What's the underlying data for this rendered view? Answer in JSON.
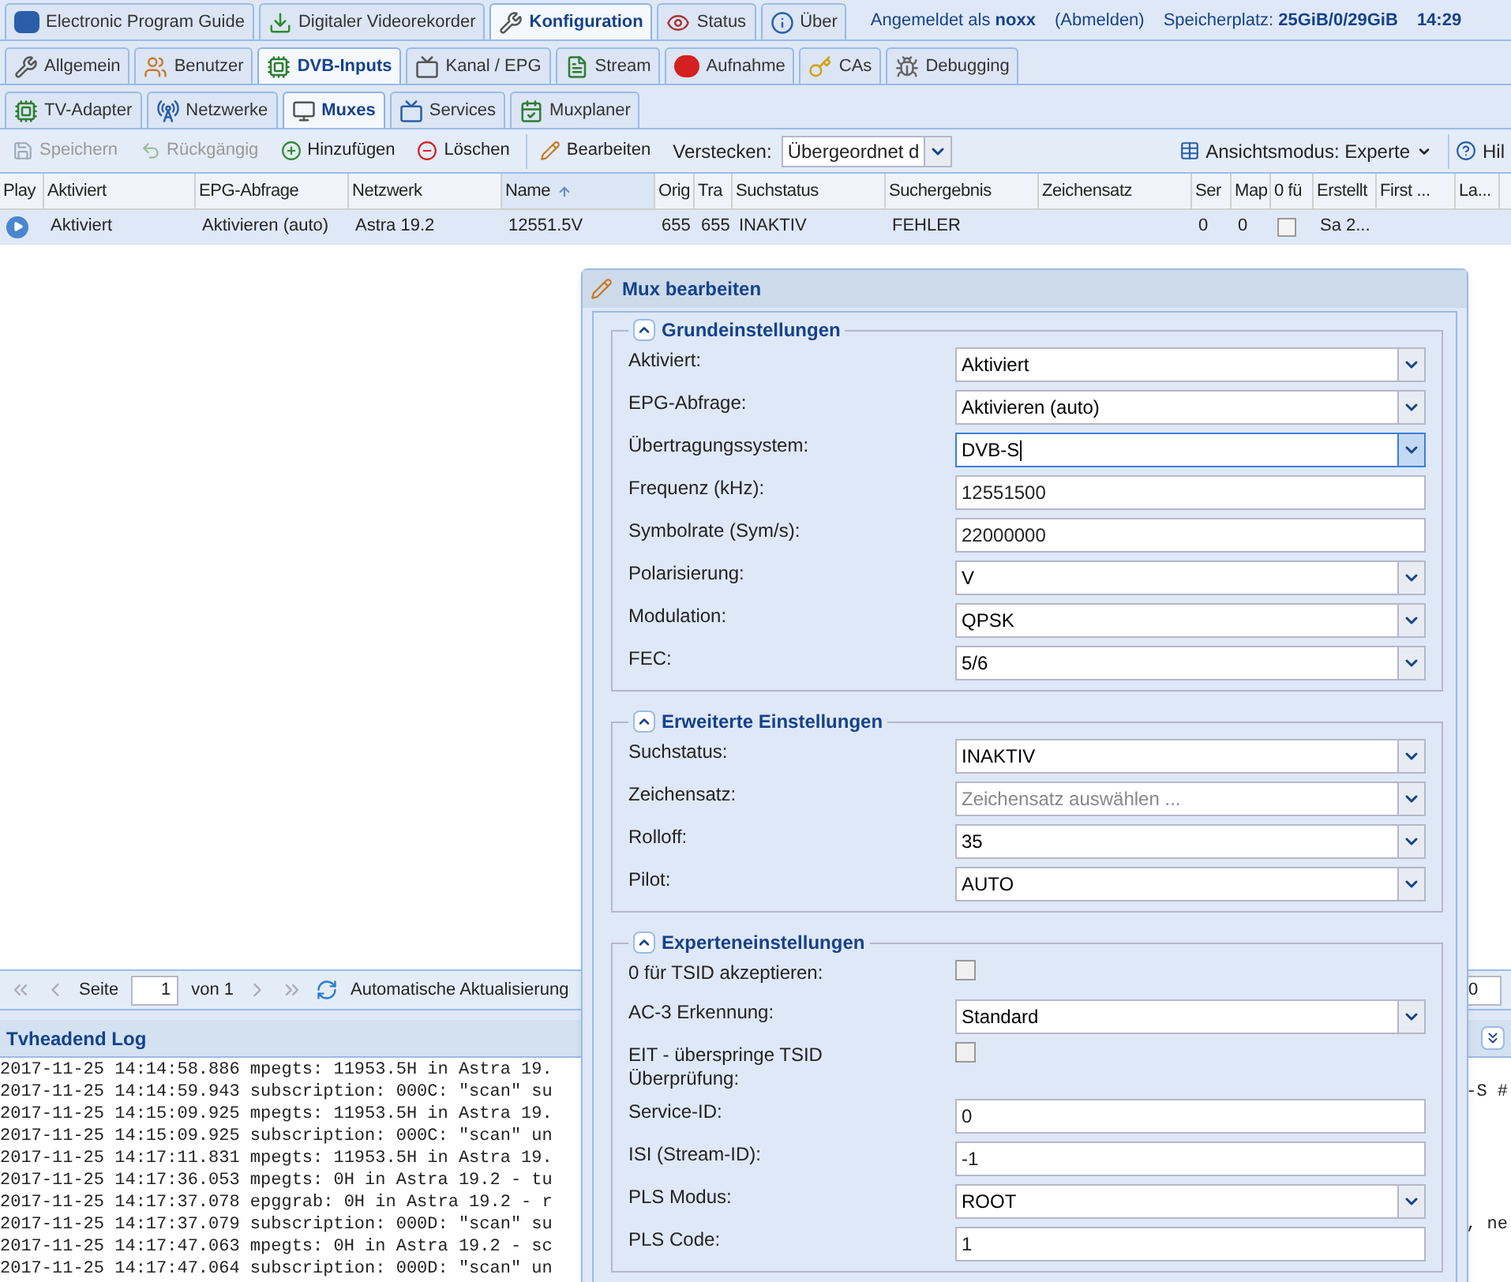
{
  "main_tabs": [
    {
      "label": "Electronic Program Guide",
      "selected": false
    },
    {
      "label": "Digitaler Videorekorder",
      "selected": false
    },
    {
      "label": "Konfiguration",
      "selected": true
    },
    {
      "label": "Status",
      "selected": false
    },
    {
      "label": "Über",
      "selected": false
    }
  ],
  "session": {
    "user": "Angemeldet als **noxx**",
    "logout": "(Abmelden)",
    "storage": "Speicherplatz: **25GiB/0/29GiB**",
    "time": "14:29"
  },
  "config_tabs": [
    {
      "label": "Allgemein",
      "selected": false
    },
    {
      "label": "Benutzer",
      "selected": false
    },
    {
      "label": "DVB-Inputs",
      "selected": true
    },
    {
      "label": "Kanal / EPG",
      "selected": false
    },
    {
      "label": "Stream",
      "selected": false
    },
    {
      "label": "Aufnahme",
      "selected": false
    },
    {
      "label": "CAs",
      "selected": false
    },
    {
      "label": "Debugging",
      "selected": false
    }
  ],
  "sub_tabs": [
    {
      "label": "TV-Adapter",
      "selected": false
    },
    {
      "label": "Netzwerke",
      "selected": false
    },
    {
      "label": "Muxes",
      "selected": true
    },
    {
      "label": "Services",
      "selected": false
    },
    {
      "label": "Muxplaner",
      "selected": false
    }
  ],
  "toolbar": {
    "buttons": [
      {
        "label": "Speichern",
        "disabled": true
      },
      {
        "label": "Rückgängig",
        "disabled": true
      },
      {
        "label": "Hinzufügen",
        "disabled": false
      },
      {
        "label": "Löschen",
        "disabled": false
      },
      {
        "label": "Bearbeiten",
        "disabled": false
      }
    ],
    "hide_label": "Verstecken:",
    "hide_value": "Übergeordnet d",
    "view_mode": "Ansichtsmodus: Experte",
    "help": "Hil"
  },
  "table": {
    "columns": [
      {
        "label": "Play",
        "sorted": false
      },
      {
        "label": "Aktiviert",
        "sorted": false
      },
      {
        "label": "EPG-Abfrage",
        "sorted": false
      },
      {
        "label": "Netzwerk",
        "sorted": false
      },
      {
        "label": "Name",
        "sorted": true
      },
      {
        "label": "Orig",
        "sorted": false
      },
      {
        "label": "Tra",
        "sorted": false
      },
      {
        "label": "Suchstatus",
        "sorted": false
      },
      {
        "label": "Suchergebnis",
        "sorted": false
      },
      {
        "label": "Zeichensatz",
        "sorted": false
      },
      {
        "label": "Ser",
        "sorted": false
      },
      {
        "label": "Map",
        "sorted": false
      },
      {
        "label": "0 fü",
        "sorted": false
      },
      {
        "label": "Erstellt",
        "sorted": false
      },
      {
        "label": "First ...",
        "sorted": false
      },
      {
        "label": "La...",
        "sorted": false
      }
    ],
    "rows": [
      {
        "selected": true,
        "cells": [
          {
            "kind": "play"
          },
          {
            "kind": "text",
            "text": "Aktiviert"
          },
          {
            "kind": "text",
            "text": "Aktivieren (auto)"
          },
          {
            "kind": "text",
            "text": "Astra 19.2"
          },
          {
            "kind": "text",
            "text": "12551.5V"
          },
          {
            "kind": "text",
            "text": "655"
          },
          {
            "kind": "text",
            "text": "655"
          },
          {
            "kind": "text",
            "text": "INAKTIV"
          },
          {
            "kind": "text",
            "text": "FEHLER"
          },
          {
            "kind": "empty"
          },
          {
            "kind": "text",
            "text": "0"
          },
          {
            "kind": "text",
            "text": "0"
          },
          {
            "kind": "checkbox",
            "checked": false
          },
          {
            "kind": "text",
            "text": "Sa 2..."
          },
          {
            "kind": "empty"
          },
          {
            "kind": "empty"
          }
        ]
      }
    ]
  },
  "paging": {
    "page_label": "Seite",
    "page": "1",
    "of": "von 1",
    "auto_refresh": "Automatische Aktualisierung",
    "page_size": "0"
  },
  "log": {
    "title": "Tvheadend Log",
    "lines": [
      {
        "text": "2017-11-25 14:14:58.886 mpegts: 11953.5H in Astra 19."
      },
      {
        "text": "2017-11-25 14:14:59.943 subscription: 000C: \"scan\" su",
        "tail": "-S #"
      },
      {
        "text": "2017-11-25 14:15:09.925 mpegts: 11953.5H in Astra 19."
      },
      {
        "text": "2017-11-25 14:15:09.925 subscription: 000C: \"scan\" un"
      },
      {
        "text": "2017-11-25 14:17:11.831 mpegts: 11953.5H in Astra 19."
      },
      {
        "text": "2017-11-25 14:17:36.053 mpegts: 0H in Astra 19.2 - tu"
      },
      {
        "text": "2017-11-25 14:17:37.078 epggrab: 0H in Astra 19.2 - r"
      },
      {
        "text": "2017-11-25 14:17:37.079 subscription: 000D: \"scan\" su",
        "tail": ", ne"
      },
      {
        "text": "2017-11-25 14:17:47.063 mpegts: 0H in Astra 19.2 - sc"
      },
      {
        "text": "2017-11-25 14:17:47.064 subscription: 000D: \"scan\" un"
      }
    ]
  },
  "dialog": {
    "title": "Mux bearbeiten",
    "sections": [
      {
        "title": "Grundeinstellungen",
        "fields": [
          {
            "label": "Aktiviert:",
            "kind": "select",
            "value": "Aktiviert",
            "focused": false
          },
          {
            "label": "EPG-Abfrage:",
            "kind": "select",
            "value": "Aktivieren (auto)",
            "focused": false
          },
          {
            "label": "Übertragungssystem:",
            "kind": "select",
            "value": "DVB-S",
            "focused": true
          },
          {
            "label": "Frequenz (kHz):",
            "kind": "text",
            "value": "12551500",
            "focused": false
          },
          {
            "label": "Symbolrate (Sym/s):",
            "kind": "text",
            "value": "22000000",
            "focused": false
          },
          {
            "label": "Polarisierung:",
            "kind": "select",
            "value": "V",
            "focused": false
          },
          {
            "label": "Modulation:",
            "kind": "select",
            "value": "QPSK",
            "focused": false
          },
          {
            "label": "FEC:",
            "kind": "select",
            "value": "5/6",
            "focused": false
          }
        ]
      },
      {
        "title": "Erweiterte Einstellungen",
        "fields": [
          {
            "label": "Suchstatus:",
            "kind": "select",
            "value": "INAKTIV",
            "focused": false
          },
          {
            "label": "Zeichensatz:",
            "kind": "select",
            "placeholder": "Zeichensatz auswählen ...",
            "focused": false
          },
          {
            "label": "Rolloff:",
            "kind": "select",
            "value": "35",
            "focused": false
          },
          {
            "label": "Pilot:",
            "kind": "select",
            "value": "AUTO",
            "focused": false
          }
        ]
      },
      {
        "title": "Experteneinstellungen",
        "fields": [
          {
            "label": "0 für TSID akzeptieren:",
            "kind": "checkbox",
            "checked": false
          },
          {
            "label": "AC-3 Erkennung:",
            "kind": "select",
            "value": "Standard",
            "focused": false
          },
          {
            "label": "EIT - überspringe TSID Überprüfung:",
            "kind": "checkbox",
            "checked": false
          },
          {
            "label": "Service-ID:",
            "kind": "text",
            "value": "0",
            "focused": false
          },
          {
            "label": "ISI (Stream-ID):",
            "kind": "text",
            "value": "-1",
            "focused": false
          },
          {
            "label": "PLS Modus:",
            "kind": "select",
            "value": "ROOT",
            "focused": false
          },
          {
            "label": "PLS Code:",
            "kind": "text",
            "value": "1",
            "focused": false
          }
        ]
      }
    ]
  }
}
